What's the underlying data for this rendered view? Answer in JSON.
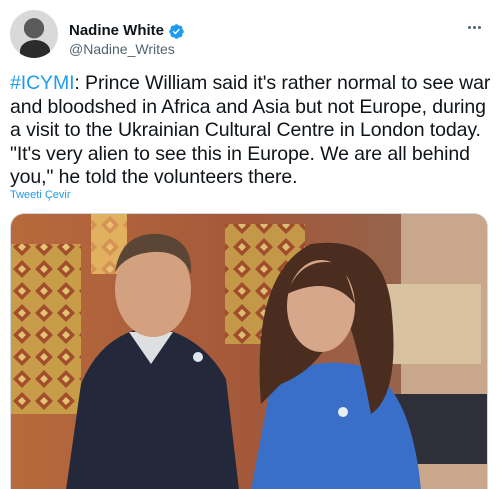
{
  "author": {
    "display_name": "Nadine White",
    "handle": "@Nadine_Writes",
    "verified": true,
    "avatar_icon": "avatar-photo"
  },
  "tweet": {
    "hashtag": "#ICYMI",
    "body": ": Prince William said it's rather normal to see war and bloodshed in Africa and Asia but not Europe, during a visit to the Ukrainian Cultural Centre in London today. \"It's very alien to see this in Europe. We are all behind you,\" he told the volunteers there."
  },
  "translate_label": "Tweeti Çevir",
  "icons": {
    "more": "more-options-icon",
    "verified": "verified-badge-icon"
  },
  "colors": {
    "accent": "#1d9bf0",
    "text": "#0f1419",
    "secondary": "#536471"
  }
}
